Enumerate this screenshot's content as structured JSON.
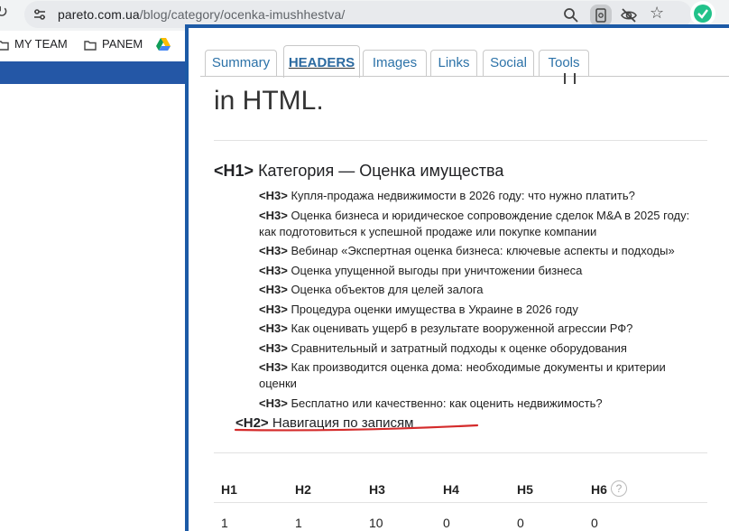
{
  "browser": {
    "url_host": "pareto.com.ua",
    "url_path": "/blog/category/ocenka-imushhestva/",
    "bookmarks": [
      {
        "label": "MY TEAM",
        "icon": "folder-icon"
      },
      {
        "label": "PANEM",
        "icon": "folder-icon"
      },
      {
        "label": "",
        "icon": "google-drive-icon"
      }
    ]
  },
  "extension": {
    "tabs": [
      {
        "label": "Summary",
        "active": false
      },
      {
        "label": "HEADERS",
        "active": true
      },
      {
        "label": "Images",
        "active": false
      },
      {
        "label": "Links",
        "active": false
      },
      {
        "label": "Social",
        "active": false
      },
      {
        "label": "Tools",
        "active": false
      }
    ],
    "intro_text": "in HTML.",
    "h1": {
      "tag": "<H1>",
      "text": "Категория — Оценка имущества"
    },
    "h3": [
      {
        "tag": "<H3>",
        "text": "Купля-продажа недвижимости в 2026 году: что нужно платить?"
      },
      {
        "tag": "<H3>",
        "text": "Оценка бизнеса и юридическое сопровождение сделок M&A в 2025 году: как подготовиться к успешной продаже или покупке компании"
      },
      {
        "tag": "<H3>",
        "text": "Вебинар «Экспертная оценка бизнеса: ключевые аспекты и подходы»"
      },
      {
        "tag": "<H3>",
        "text": "Оценка упущенной выгоды при уничтожении бизнеса"
      },
      {
        "tag": "<H3>",
        "text": "Оценка объектов для целей залога"
      },
      {
        "tag": "<H3>",
        "text": "Процедура оценки имущества в Украине в 2026 году"
      },
      {
        "tag": "<H3>",
        "text": "Как оценивать ущерб в результате вооруженной агрессии РФ?"
      },
      {
        "tag": "<H3>",
        "text": "Сравнительный и затратный подходы к оценке оборудования"
      },
      {
        "tag": "<H3>",
        "text": "Как производится оценка дома: необходимые документы и критерии оценки"
      },
      {
        "tag": "<H3>",
        "text": "Бесплатно или качественно: как оценить недвижимость?"
      }
    ],
    "h2": {
      "tag": "<H2>",
      "text": "Навигация по записям"
    },
    "table": {
      "headers": [
        "H1",
        "H2",
        "H3",
        "H4",
        "H5",
        "H6"
      ],
      "help_icon": "?",
      "values": [
        "1",
        "1",
        "10",
        "0",
        "0",
        "0"
      ]
    }
  },
  "colors": {
    "tab_link": "#2c72a8",
    "panel_border": "#1c5aa6",
    "annotation_line": "#d42b2b"
  }
}
